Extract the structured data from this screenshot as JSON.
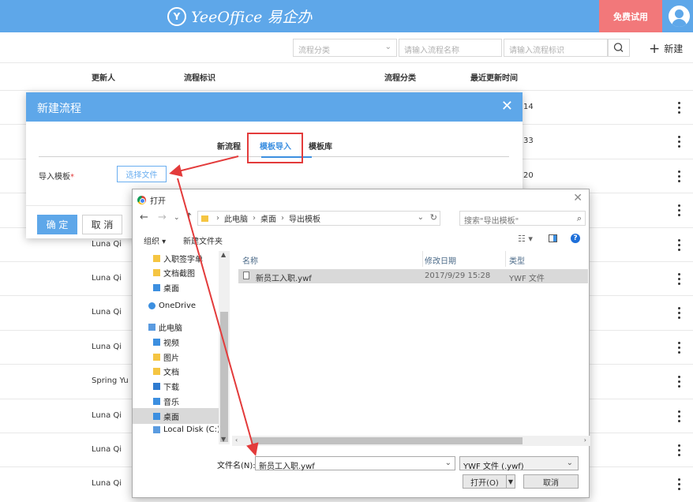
{
  "header": {
    "logo_mark": "Y",
    "logo_text": "YeeOffice 易企办",
    "trial_label": "免费试用"
  },
  "filters": {
    "category_placeholder": "流程分类",
    "name_placeholder": "请输入流程名称",
    "id_placeholder": "请输入流程标识",
    "new_label": "新建",
    "new_icon": "+"
  },
  "table": {
    "headers": [
      "更新人",
      "流程标识",
      "流程分类",
      "最近更新时间"
    ],
    "rows": [
      {
        "who": "",
        "num": "14"
      },
      {
        "who": "",
        "num": "33"
      },
      {
        "who": "",
        "num": "20"
      },
      {
        "who": "",
        "num": ""
      },
      {
        "who": "Luna Qi",
        "num": ""
      },
      {
        "who": "Luna Qi",
        "num": ""
      },
      {
        "who": "Luna Qi",
        "num": ""
      },
      {
        "who": "Luna Qi",
        "num": ""
      },
      {
        "who": "Spring Yu",
        "num": ""
      },
      {
        "who": "Luna Qi",
        "num": ""
      },
      {
        "who": "Luna Qi",
        "num": ""
      },
      {
        "who": "Luna Qi",
        "num": ""
      }
    ]
  },
  "modal": {
    "title": "新建流程",
    "close": "✕",
    "tabs": [
      "新流程",
      "模板导入",
      "模板库"
    ],
    "import_label": "导入模板",
    "required_mark": "*",
    "choose_file": "选择文件",
    "ok": "确 定",
    "cancel": "取 消"
  },
  "file_dialog": {
    "title": "打开",
    "close": "✕",
    "path": [
      "此电脑",
      "桌面",
      "导出模板"
    ],
    "search_placeholder": "搜索\"导出模板\"",
    "organize": "组织 ▾",
    "new_folder": "新建文件夹",
    "tree": [
      "入职签字单",
      "文档截图",
      "桌面",
      "OneDrive",
      "此电脑",
      "视频",
      "图片",
      "文档",
      "下载",
      "音乐",
      "桌面",
      "Local Disk (C:)"
    ],
    "columns": [
      "名称",
      "修改日期",
      "类型"
    ],
    "file": {
      "name": "新员工入职.ywf",
      "date": "2017/9/29 15:28",
      "type": "YWF 文件"
    },
    "filename_label": "文件名(N):",
    "filename_value": "新员工入职.ywf",
    "filetype": "YWF 文件 (.ywf)",
    "open": "打开(O)",
    "cancel": "取消"
  },
  "colors": {
    "brand": "#5ea7e9",
    "trial": "#f2787a",
    "annotation": "#e33b3b"
  }
}
